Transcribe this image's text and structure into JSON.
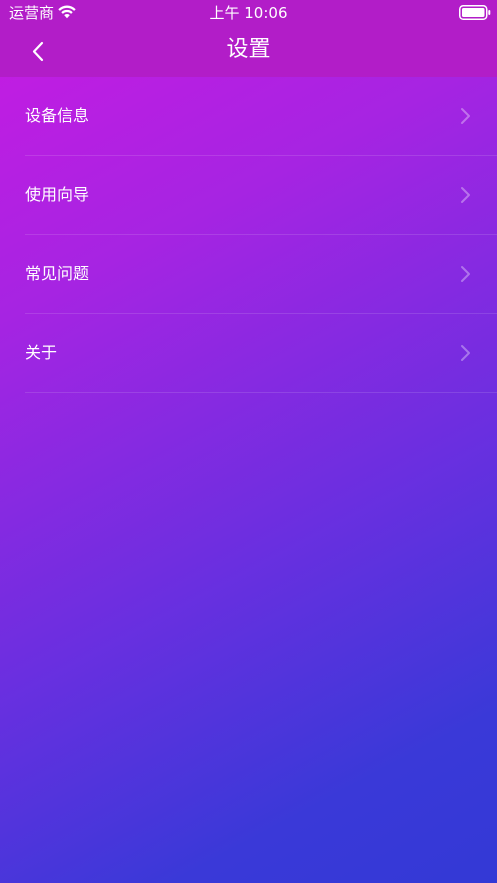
{
  "status_bar": {
    "carrier": "运营商",
    "time": "上午 10:06"
  },
  "nav": {
    "title": "设置"
  },
  "settings": {
    "items": [
      {
        "label": "设备信息"
      },
      {
        "label": "使用向导"
      },
      {
        "label": "常见问题"
      },
      {
        "label": "关于"
      }
    ]
  },
  "icons": {
    "back": "chevron-left-icon",
    "row": "chevron-right-icon",
    "wifi": "wifi-icon",
    "battery": "battery-icon"
  },
  "colors": {
    "nav_background": "#b21dc8",
    "gradient_start": "#c81be2",
    "gradient_end": "#3339d6",
    "text": "#ffffff"
  }
}
